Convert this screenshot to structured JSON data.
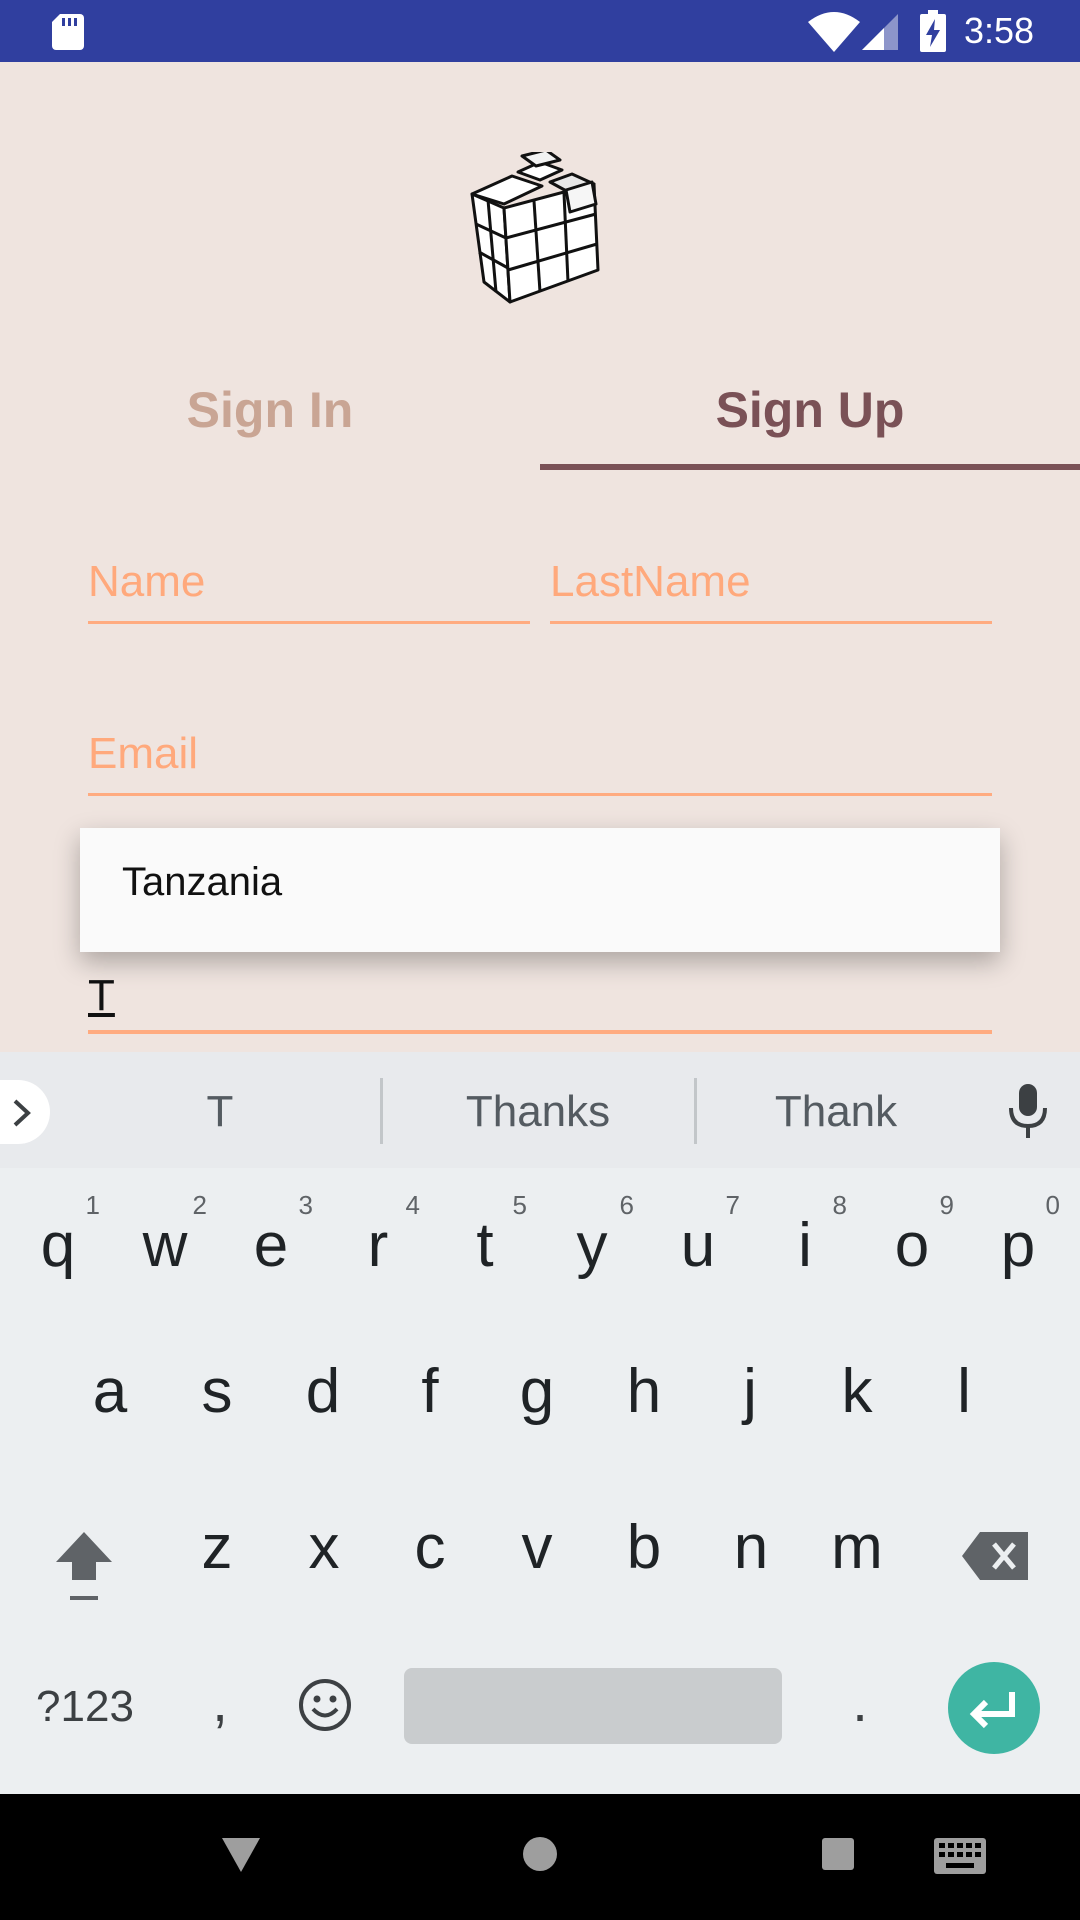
{
  "status_bar": {
    "time": "3:58",
    "background": "#303f9f",
    "icons": [
      "sd-card-icon",
      "wifi-icon",
      "signal-icon",
      "battery-charging-icon"
    ]
  },
  "app": {
    "logo_icon": "cube-puzzle-logo-icon",
    "tabs": [
      {
        "label": "Sign In",
        "selected": false
      },
      {
        "label": "Sign Up",
        "selected": true
      }
    ],
    "form": {
      "name_placeholder": "Name",
      "lastname_placeholder": "LastName",
      "email_placeholder": "Email",
      "country_value": "T"
    },
    "autocomplete": {
      "items": [
        "Tanzania"
      ]
    },
    "colors": {
      "background": "#efe4df",
      "accent": "#ffab80",
      "tab_selected": "#7a5156",
      "tab_unselected": "#c9a594"
    }
  },
  "keyboard": {
    "suggestions": [
      "T",
      "Thanks",
      "Thank"
    ],
    "rows": [
      [
        {
          "label": "q",
          "hint": "1"
        },
        {
          "label": "w",
          "hint": "2"
        },
        {
          "label": "e",
          "hint": "3"
        },
        {
          "label": "r",
          "hint": "4"
        },
        {
          "label": "t",
          "hint": "5"
        },
        {
          "label": "y",
          "hint": "6"
        },
        {
          "label": "u",
          "hint": "7"
        },
        {
          "label": "i",
          "hint": "8"
        },
        {
          "label": "o",
          "hint": "9"
        },
        {
          "label": "p",
          "hint": "0"
        }
      ],
      [
        {
          "label": "a"
        },
        {
          "label": "s"
        },
        {
          "label": "d"
        },
        {
          "label": "f"
        },
        {
          "label": "g"
        },
        {
          "label": "h"
        },
        {
          "label": "j"
        },
        {
          "label": "k"
        },
        {
          "label": "l"
        }
      ],
      [
        {
          "label": "z"
        },
        {
          "label": "x"
        },
        {
          "label": "c"
        },
        {
          "label": "v"
        },
        {
          "label": "b"
        },
        {
          "label": "n"
        },
        {
          "label": "m"
        }
      ]
    ],
    "symbols_label": "?123",
    "comma_label": ",",
    "period_label": ".",
    "accent": "#3fb5a3"
  },
  "nav_bar": {
    "icons": [
      "back-icon",
      "home-icon",
      "recents-icon",
      "keyboard-switch-icon"
    ]
  }
}
